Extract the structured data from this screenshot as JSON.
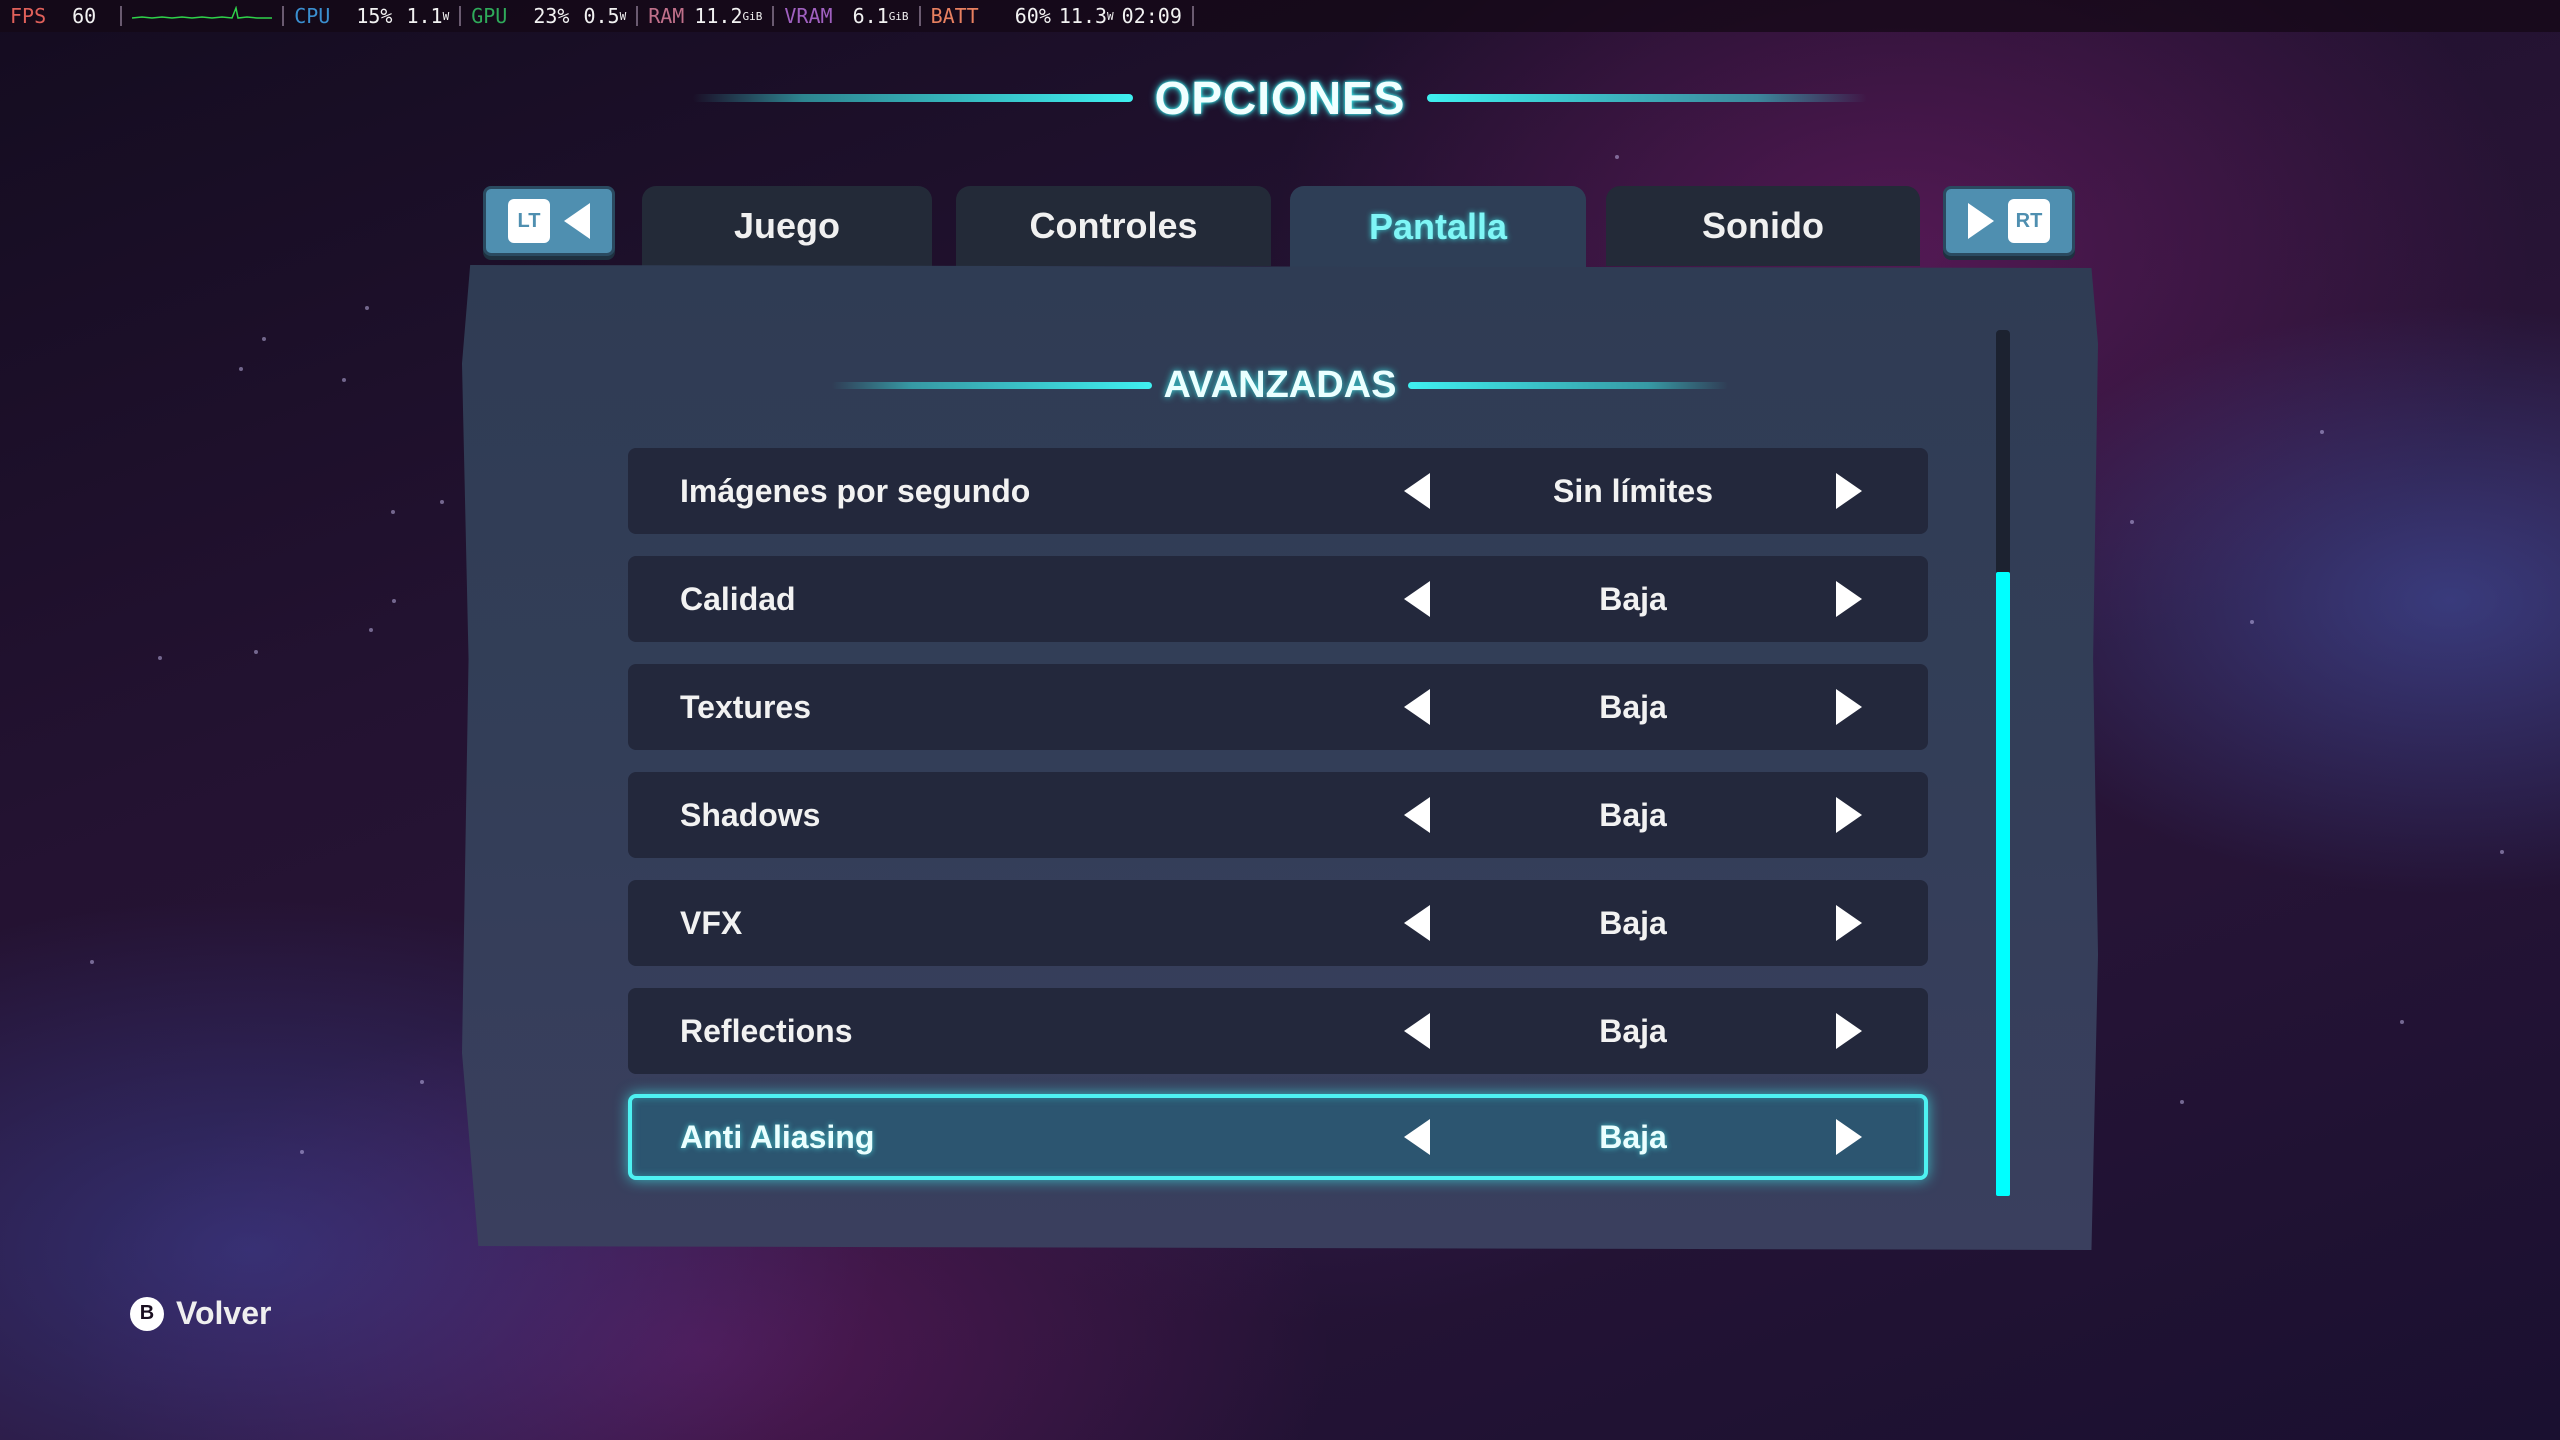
{
  "hud": {
    "fps": {
      "label": "FPS",
      "value": "60",
      "color": "#e0605a"
    },
    "cpu": {
      "label": "CPU",
      "usage": "15%",
      "power": "1.1",
      "power_unit": "W",
      "color": "#3a8fd0"
    },
    "gpu": {
      "label": "GPU",
      "usage": "23%",
      "power": "0.5",
      "power_unit": "W",
      "color": "#2faa5a"
    },
    "ram": {
      "label": "RAM",
      "value": "11.2",
      "unit": "GiB",
      "color": "#c0708a"
    },
    "vram": {
      "label": "VRAM",
      "value": "6.1",
      "unit": "GiB",
      "color": "#a060c0"
    },
    "batt": {
      "label": "BATT",
      "percent": "60%",
      "power": "11.3",
      "power_unit": "W",
      "time": "02:09",
      "color": "#e88060"
    }
  },
  "header": {
    "title": "OPCIONES"
  },
  "tabs": {
    "prev_key": "LT",
    "next_key": "RT",
    "items": [
      {
        "label": "Juego",
        "active": false
      },
      {
        "label": "Controles",
        "active": false
      },
      {
        "label": "Pantalla",
        "active": true
      },
      {
        "label": "Sonido",
        "active": false
      }
    ]
  },
  "section": {
    "title": "AVANZADAS",
    "settings": [
      {
        "label": "Imágenes por segundo",
        "value": "Sin límites",
        "selected": false
      },
      {
        "label": "Calidad",
        "value": "Baja",
        "selected": false
      },
      {
        "label": "Textures",
        "value": "Baja",
        "selected": false
      },
      {
        "label": "Shadows",
        "value": "Baja",
        "selected": false
      },
      {
        "label": "VFX",
        "value": "Baja",
        "selected": false
      },
      {
        "label": "Reflections",
        "value": "Baja",
        "selected": false
      },
      {
        "label": "Anti Aliasing",
        "value": "Baja",
        "selected": true
      }
    ]
  },
  "scrollbar": {
    "thumb_start_fraction": 0.28,
    "thumb_end_fraction": 1.0
  },
  "footer": {
    "back_button_key": "B",
    "back_label": "Volver"
  },
  "colors": {
    "accent": "#3ff0f0",
    "scroll_thumb": "#00ffff",
    "row_bg": "#23283c",
    "row_selected_bg": "#2c5570",
    "panel_bg": "#333e58",
    "shoulder_button": "#4f8fb0"
  }
}
